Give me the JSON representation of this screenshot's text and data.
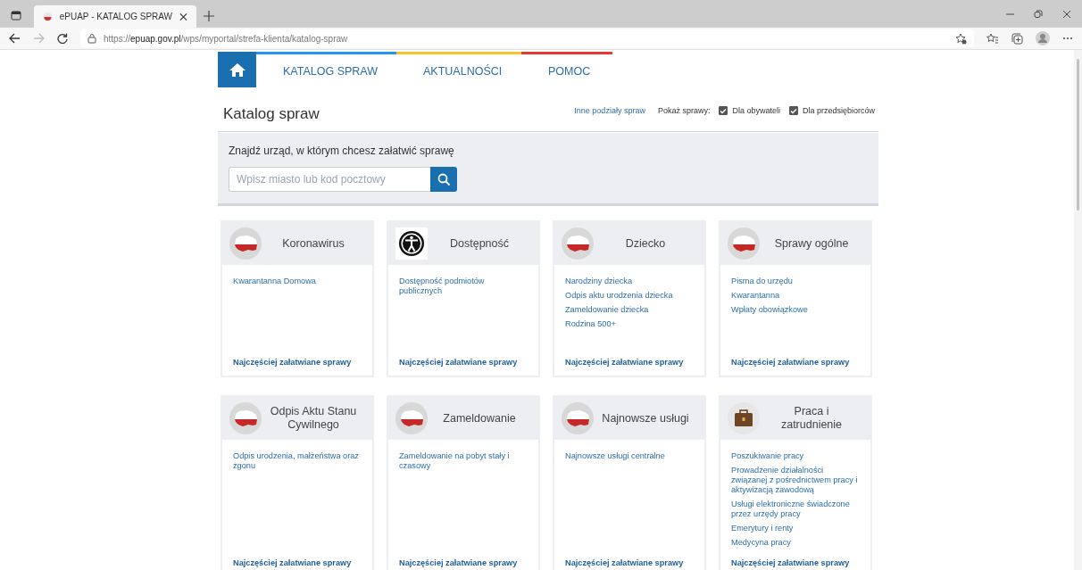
{
  "browser": {
    "tab_title": "ePUAP - KATALOG SPRAW",
    "url": "https://**epuap.gov.pl**/wps/myportal/strefa-klienta/katalog-spraw"
  },
  "nav": {
    "items": [
      {
        "label": "KATALOG SPRAW",
        "color": "#2196f3"
      },
      {
        "label": "AKTUALNOŚCI",
        "color": "#f4c430"
      },
      {
        "label": "POMOC",
        "color": "#e53935"
      }
    ]
  },
  "heading": {
    "title": "Katalog spraw",
    "other_link": "Inne podziały spraw",
    "show_label": "Pokaż sprawy:",
    "filters": [
      {
        "label": "Dla obywateli",
        "checked": true
      },
      {
        "label": "Dla przedsiębiorców",
        "checked": true
      }
    ]
  },
  "search": {
    "prompt": "Znajdź urząd, w którym chcesz załatwić sprawę",
    "placeholder": "Wpisz miasto lub kod pocztowy"
  },
  "cards": [
    {
      "title": "Koronawirus",
      "kind": "flag",
      "links": [
        "Kwarantanna Domowa"
      ],
      "footer": "Najczęściej załatwiane sprawy"
    },
    {
      "title": "Dostępność",
      "kind": "accessibility",
      "links": [
        "Dostępność podmiotów publicznych"
      ],
      "footer": "Najczęściej załatwiane sprawy"
    },
    {
      "title": "Dziecko",
      "kind": "flag",
      "links": [
        "Narodziny dziecka",
        "Odpis aktu urodzenia dziecka",
        "Zameldowanie dziecka",
        "Rodzina 500+"
      ],
      "footer": "Najczęściej załatwiane sprawy"
    },
    {
      "title": "Sprawy ogólne",
      "kind": "flag",
      "links": [
        "Pisma do urzędu",
        "Kwarantanna",
        "Wpłaty obowiązkowe"
      ],
      "footer": "Najczęściej załatwiane sprawy"
    },
    {
      "title": "Odpis Aktu Stanu Cywilnego",
      "kind": "flag",
      "links": [
        "Odpis urodzenia, małżeństwa oraz zgonu"
      ],
      "footer": "Najczęściej załatwiane sprawy"
    },
    {
      "title": "Zameldowanie",
      "kind": "flag",
      "links": [
        "Zameldowanie na pobyt stały i czasowy"
      ],
      "footer": "Najczęściej załatwiane sprawy"
    },
    {
      "title": "Najnowsze usługi",
      "kind": "flag",
      "links": [
        "Najnowsze usługi centralne"
      ],
      "footer": "Najczęściej załatwiane sprawy"
    },
    {
      "title": "Praca i zatrudnienie",
      "kind": "briefcase",
      "links": [
        "Poszukiwanie pracy",
        "Prowadzenie działalności związanej z pośrednictwem pracy i aktywizacją zawodową",
        "Usługi elektroniczne świadczone przez urzędy pracy",
        "Emerytury i renty",
        "Medycyna pracy"
      ],
      "footer": "Najczęściej załatwiane sprawy"
    }
  ]
}
